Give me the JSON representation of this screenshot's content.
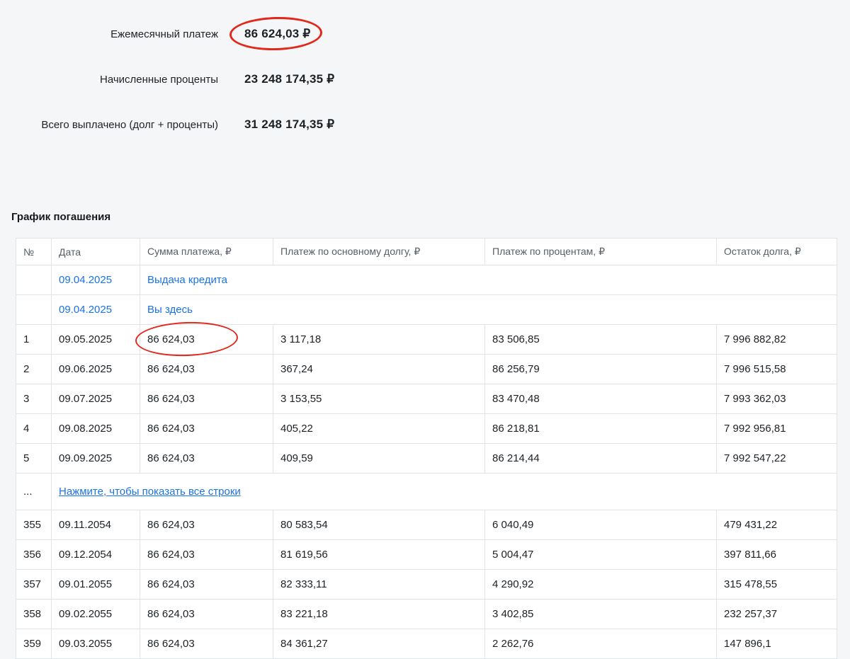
{
  "colors": {
    "link": "#1a73e8",
    "annotation": "#e0281c"
  },
  "summary": {
    "items": [
      {
        "label": "Ежемесячный платеж",
        "value": "86 624,03 ₽",
        "annotated": true
      },
      {
        "label": "Начисленные проценты",
        "value": "23 248 174,35 ₽"
      },
      {
        "label": "Всего выплачено (долг + проценты)",
        "value": "31 248 174,35 ₽"
      }
    ]
  },
  "schedule": {
    "title": "График погашения",
    "columns": [
      "№",
      "Дата",
      "Сумма платежа, ₽",
      "Платеж по основному долгу, ₽",
      "Платеж по процентам, ₽",
      "Остаток долга, ₽"
    ],
    "special_rows": [
      {
        "date": "09.04.2025",
        "label": "Выдача кредита"
      },
      {
        "date": "09.04.2025",
        "label": "Вы здесь"
      }
    ],
    "rows_top": [
      {
        "num": "1",
        "date": "09.05.2025",
        "payment": "86 624,03",
        "principal": "3 117,18",
        "interest": "83 506,85",
        "balance": "7 996 882,82",
        "annotated": true
      },
      {
        "num": "2",
        "date": "09.06.2025",
        "payment": "86 624,03",
        "principal": "367,24",
        "interest": "86 256,79",
        "balance": "7 996 515,58"
      },
      {
        "num": "3",
        "date": "09.07.2025",
        "payment": "86 624,03",
        "principal": "3 153,55",
        "interest": "83 470,48",
        "balance": "7 993 362,03"
      },
      {
        "num": "4",
        "date": "09.08.2025",
        "payment": "86 624,03",
        "principal": "405,22",
        "interest": "86 218,81",
        "balance": "7 992 956,81"
      },
      {
        "num": "5",
        "date": "09.09.2025",
        "payment": "86 624,03",
        "principal": "409,59",
        "interest": "86 214,44",
        "balance": "7 992 547,22"
      }
    ],
    "expand_row": {
      "num": "...",
      "label": "Нажмите, чтобы показать все строки"
    },
    "rows_bottom": [
      {
        "num": "355",
        "date": "09.11.2054",
        "payment": "86 624,03",
        "principal": "80 583,54",
        "interest": "6 040,49",
        "balance": "479 431,22"
      },
      {
        "num": "356",
        "date": "09.12.2054",
        "payment": "86 624,03",
        "principal": "81 619,56",
        "interest": "5 004,47",
        "balance": "397 811,66"
      },
      {
        "num": "357",
        "date": "09.01.2055",
        "payment": "86 624,03",
        "principal": "82 333,11",
        "interest": "4 290,92",
        "balance": "315 478,55"
      },
      {
        "num": "358",
        "date": "09.02.2055",
        "payment": "86 624,03",
        "principal": "83 221,18",
        "interest": "3 402,85",
        "balance": "232 257,37"
      },
      {
        "num": "359",
        "date": "09.03.2055",
        "payment": "86 624,03",
        "principal": "84 361,27",
        "interest": "2 262,76",
        "balance": "147 896,1"
      }
    ]
  }
}
